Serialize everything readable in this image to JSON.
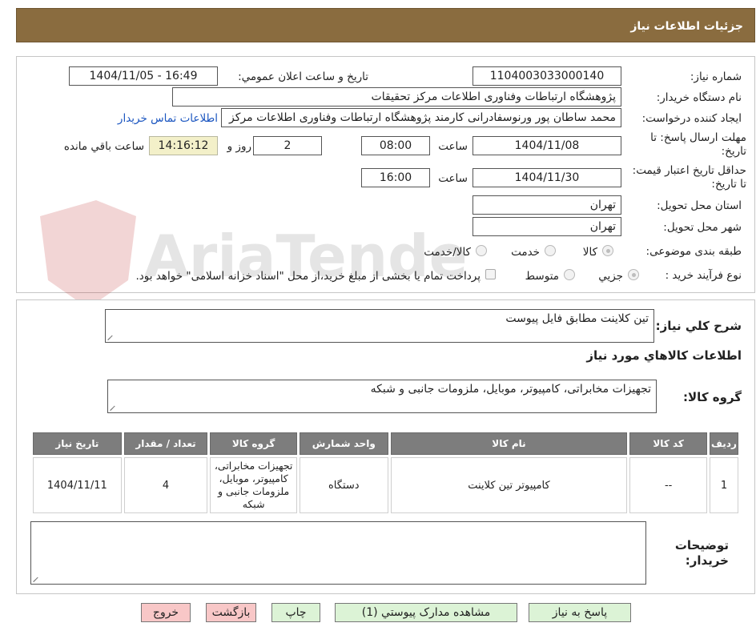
{
  "header": {
    "title": "جزئیات اطلاعات نیاز"
  },
  "watermark": {
    "text": "AriaTender.neT"
  },
  "form": {
    "need_number_label": "شماره نیاز:",
    "need_number": "1104003033000140",
    "announce_label": "تاریخ و ساعت اعلان عمومي:",
    "announce_value": "1404/11/05 - 16:49",
    "buyer_org_label": "نام دستگاه خریدار:",
    "buyer_org": "پژوهشگاه ارتباطات وفناوری اطلاعات مرکز تحقیقات",
    "creator_label": "ایجاد کننده درخواست:",
    "creator": "محمد ساطان پور ورنوسفادرانی کارمند پژوهشگاه ارتباطات وفناوری اطلاعات مرکز",
    "contact_link": "اطلاعات تماس خریدار",
    "deadline_label": "مهلت ارسال پاسخ: تا تاریخ:",
    "deadline_date": "1404/11/08",
    "time_label": "ساعت",
    "deadline_time": "08:00",
    "days": "2",
    "days_label": "روز و",
    "remaining_time": "14:16:12",
    "remaining_label": "ساعت باقي مانده",
    "validity_label": "حداقل تاریخ اعتبار قیمت: تا تاریخ:",
    "validity_date": "1404/11/30",
    "validity_time": "16:00",
    "province_label": "استان محل تحویل:",
    "province": "تهران",
    "city_label": "شهر محل تحویل:",
    "city": "تهران",
    "category_label": "طبقه بندی موضوعی:",
    "category_options": [
      "کالا",
      "خدمت",
      "کالا/خدمت"
    ],
    "process_label": "نوع فرآیند خرید :",
    "process_options": [
      "جزیي",
      "متوسط"
    ],
    "payment_note": "پرداخت تمام یا بخشی از مبلغ خرید،از محل \"اسناد خزانه اسلامی\" خواهد بود."
  },
  "summary": {
    "label": "شرح کلي نیاز:",
    "value": "تین کلاینت مطابق فایل پیوست"
  },
  "goods_section": {
    "title": "اطلاعات کالاهاي مورد نیاز",
    "group_label": "گروه کالا:",
    "group_value": "تجهیزات مخابراتی، کامپیوتر، موبایل، ملزومات جانبی و شبکه"
  },
  "table": {
    "headers": [
      "ردیف",
      "کد کالا",
      "نام کالا",
      "واحد شمارش",
      "گروه کالا",
      "تعداد / مقدار",
      "تاریخ نیاز"
    ],
    "rows": [
      [
        "1",
        "--",
        "کامپیوتر تین کلاینت",
        "دستگاه",
        "تجهیزات مخابراتی، کامپیوتر، موبایل، ملزومات جانبی و شبکه",
        "4",
        "1404/11/11"
      ]
    ]
  },
  "buyer_notes": {
    "label": "توضیحات خریدار:",
    "value": ""
  },
  "buttons": {
    "reply": "پاسخ به نیاز",
    "attachments": "مشاهده مدارک پیوستي (1)",
    "print": "چاپ",
    "back": "بازگشت",
    "exit": "خروج"
  },
  "colors": {
    "header_bg": "#8a6c3f",
    "table_header_bg": "#7d7d7d",
    "green_button": "#dcf3d6",
    "pink_button": "#f8c7c7",
    "link": "#1a55c0"
  }
}
